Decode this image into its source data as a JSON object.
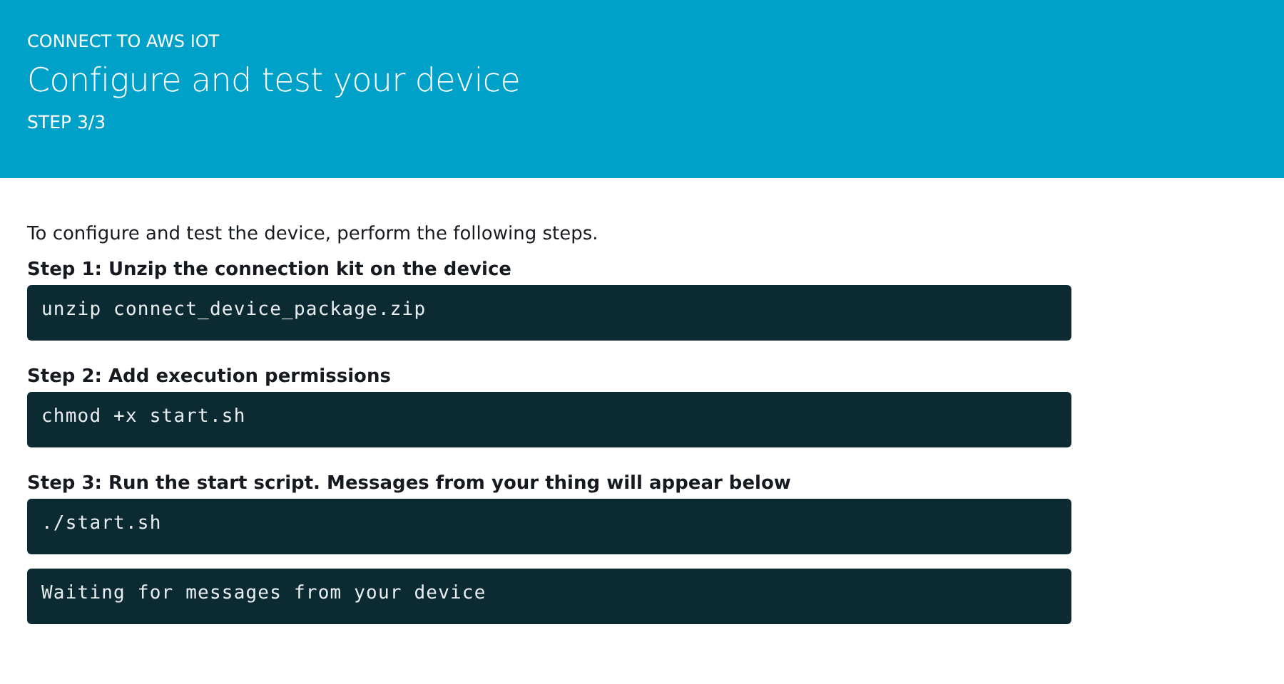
{
  "header": {
    "eyebrow": "CONNECT TO AWS IOT",
    "title": "Configure and test your device",
    "step": "STEP 3/3"
  },
  "intro": "To configure and test the device, perform the following steps.",
  "steps": [
    {
      "heading": "Step 1: Unzip the connection kit on the device",
      "blocks": [
        "unzip connect_device_package.zip"
      ]
    },
    {
      "heading": "Step 2: Add execution permissions",
      "blocks": [
        "chmod +x start.sh"
      ]
    },
    {
      "heading": "Step 3: Run the start script. Messages from your thing will appear below",
      "blocks": [
        "./start.sh",
        "Waiting for messages from your device"
      ]
    }
  ]
}
